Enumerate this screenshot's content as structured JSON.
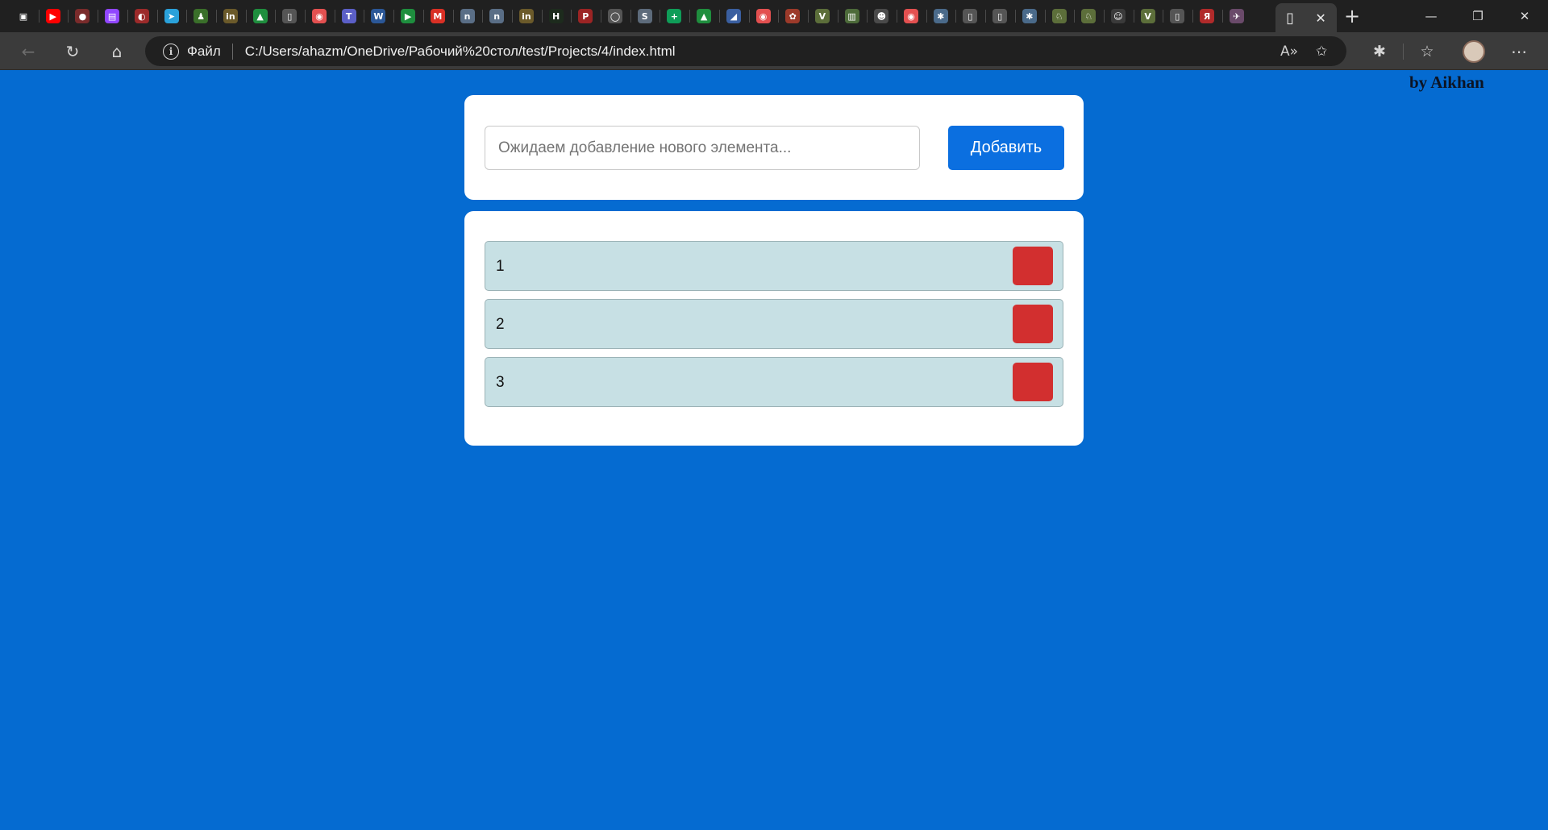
{
  "browser": {
    "tab_favicons": [
      {
        "name": "tab-actions-icon",
        "color": "#202020",
        "glyph": "▣"
      },
      {
        "name": "youtube-icon",
        "color": "#ff0000",
        "glyph": "▶"
      },
      {
        "name": "app-icon",
        "color": "#7a2b2b",
        "glyph": "●"
      },
      {
        "name": "twitch-icon",
        "color": "#9146ff",
        "glyph": "▤"
      },
      {
        "name": "app-icon",
        "color": "#9c2a2a",
        "glyph": "◐"
      },
      {
        "name": "telegram-icon",
        "color": "#2aa1da",
        "glyph": "➤"
      },
      {
        "name": "app-icon",
        "color": "#3a6f2a",
        "glyph": "♟"
      },
      {
        "name": "in-icon",
        "color": "#6b5a2a",
        "glyph": "in"
      },
      {
        "name": "drive-icon",
        "color": "#1f8e3e",
        "glyph": "▲"
      },
      {
        "name": "document-icon",
        "color": "#555555",
        "glyph": "▯"
      },
      {
        "name": "record-icon",
        "color": "#e35050",
        "glyph": "◉"
      },
      {
        "name": "teams-icon",
        "color": "#5b5fc7",
        "glyph": "T"
      },
      {
        "name": "word-icon",
        "color": "#2b5797",
        "glyph": "W"
      },
      {
        "name": "meet-icon",
        "color": "#1e8e3e",
        "glyph": "▶"
      },
      {
        "name": "gmail-icon",
        "color": "#d93025",
        "glyph": "M"
      },
      {
        "name": "app-icon",
        "color": "#5a6e86",
        "glyph": "n"
      },
      {
        "name": "app-icon",
        "color": "#5a6e86",
        "glyph": "n"
      },
      {
        "name": "in-icon",
        "color": "#6b5a2a",
        "glyph": "in"
      },
      {
        "name": "app-icon",
        "color": "#1d2b1d",
        "glyph": "H"
      },
      {
        "name": "pdf-icon",
        "color": "#9c2424",
        "glyph": "P"
      },
      {
        "name": "github-icon",
        "color": "#555555",
        "glyph": "◯"
      },
      {
        "name": "app-icon",
        "color": "#5d6b7b",
        "glyph": "S"
      },
      {
        "name": "sheets-icon",
        "color": "#0f9d58",
        "glyph": "+"
      },
      {
        "name": "drive-icon",
        "color": "#1f8e3e",
        "glyph": "▲"
      },
      {
        "name": "app-icon",
        "color": "#3a5fa0",
        "glyph": "◢"
      },
      {
        "name": "record-icon",
        "color": "#e35050",
        "glyph": "◉"
      },
      {
        "name": "app-icon",
        "color": "#9c3a2a",
        "glyph": "✿"
      },
      {
        "name": "v-icon",
        "color": "#5c6e3a",
        "glyph": "V"
      },
      {
        "name": "app-icon",
        "color": "#4d6b3a",
        "glyph": "▥"
      },
      {
        "name": "app-icon",
        "color": "#4a4a4a",
        "glyph": "☻"
      },
      {
        "name": "record-icon",
        "color": "#e35050",
        "glyph": "◉"
      },
      {
        "name": "app-icon",
        "color": "#4a6a8a",
        "glyph": "✱"
      },
      {
        "name": "document-icon",
        "color": "#555555",
        "glyph": "▯"
      },
      {
        "name": "document-icon",
        "color": "#555555",
        "glyph": "▯"
      },
      {
        "name": "app-icon",
        "color": "#4a6a8a",
        "glyph": "✱"
      },
      {
        "name": "app-icon",
        "color": "#5c6e3a",
        "glyph": "♘"
      },
      {
        "name": "app-icon",
        "color": "#5c6e3a",
        "glyph": "♘"
      },
      {
        "name": "app-icon",
        "color": "#3a3a3a",
        "glyph": "☺"
      },
      {
        "name": "v-icon",
        "color": "#5c6e3a",
        "glyph": "V"
      },
      {
        "name": "document-icon",
        "color": "#555555",
        "glyph": "▯"
      },
      {
        "name": "yandex-icon",
        "color": "#b02a2a",
        "glyph": "Я"
      },
      {
        "name": "rocket-icon",
        "color": "#6a4a6a",
        "glyph": "✈"
      }
    ],
    "active_tab_icon": "document-icon",
    "close_tab_icon": "close-icon",
    "new_tab_icon": "plus-icon",
    "address_scheme": "Файл",
    "address_url": "C:/Users/ahazm/OneDrive/Рабочий%20стол/test/Projects/4/index.html"
  },
  "page": {
    "byline": "by Aikhan",
    "input_placeholder": "Ожидаем добавление нового элемента...",
    "add_button_label": "Добавить",
    "items": [
      "1",
      "2",
      "3"
    ]
  },
  "colors": {
    "page_background": "#056bd1",
    "add_button": "#0b6fe0",
    "item_background": "#c7e0e4",
    "delete_button": "#d22f2f"
  }
}
